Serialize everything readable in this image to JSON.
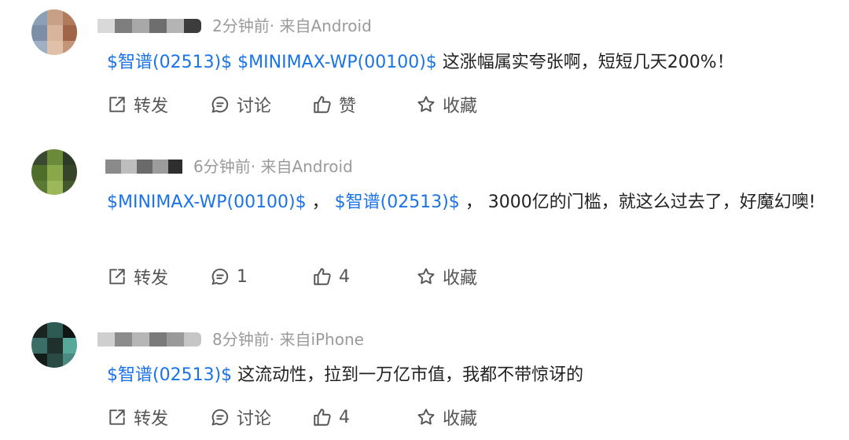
{
  "comments": [
    {
      "meta": "2分钟前· 来自Android",
      "tags": [
        "$智谱(02513)$",
        "$MINIMAX-WP(00100)$"
      ],
      "sep1": "  ",
      "text": " 这涨幅属实夸张啊，短短几天200%！",
      "actions": {
        "forward": "转发",
        "discuss": "讨论",
        "like": "赞",
        "favorite": "收藏"
      },
      "avatar_colors": [
        "#8aa0b4",
        "#c8a088",
        "#b07a5c",
        "#7d8fa6",
        "#d8b49c",
        "#a06448",
        "#9fb0c4",
        "#e0c0a8",
        "#c49478"
      ]
    },
    {
      "meta": "6分钟前· 来自Android",
      "tags": [
        "$MINIMAX-WP(00100)$",
        "$智谱(02513)$"
      ],
      "sep1": " ，",
      "text": " ， 3000亿的门槛，就这么过去了，好魔幻噢!",
      "actions": {
        "forward": "转发",
        "discuss": "1",
        "like": "4",
        "favorite": "收藏"
      },
      "avatar_colors": [
        "#3a4a30",
        "#6b8a3a",
        "#2e3a28",
        "#4f6e2c",
        "#8aa84a",
        "#36442a",
        "#5a7a34",
        "#9cb85a",
        "#445a2e"
      ]
    },
    {
      "meta": "8分钟前· 来自iPhone",
      "tags": [
        "$智谱(02513)$"
      ],
      "sep1": "",
      "text": " 这流动性，拉到一万亿市值，我都不带惊讶的",
      "actions": {
        "forward": "转发",
        "discuss": "讨论",
        "like": "4",
        "favorite": "收藏"
      },
      "avatar_colors": [
        "#1c2422",
        "#2e5a54",
        "#0f1614",
        "#3a6e66",
        "#20302c",
        "#58a89a",
        "#141c1a",
        "#2a4a44",
        "#4a8a80"
      ]
    }
  ]
}
